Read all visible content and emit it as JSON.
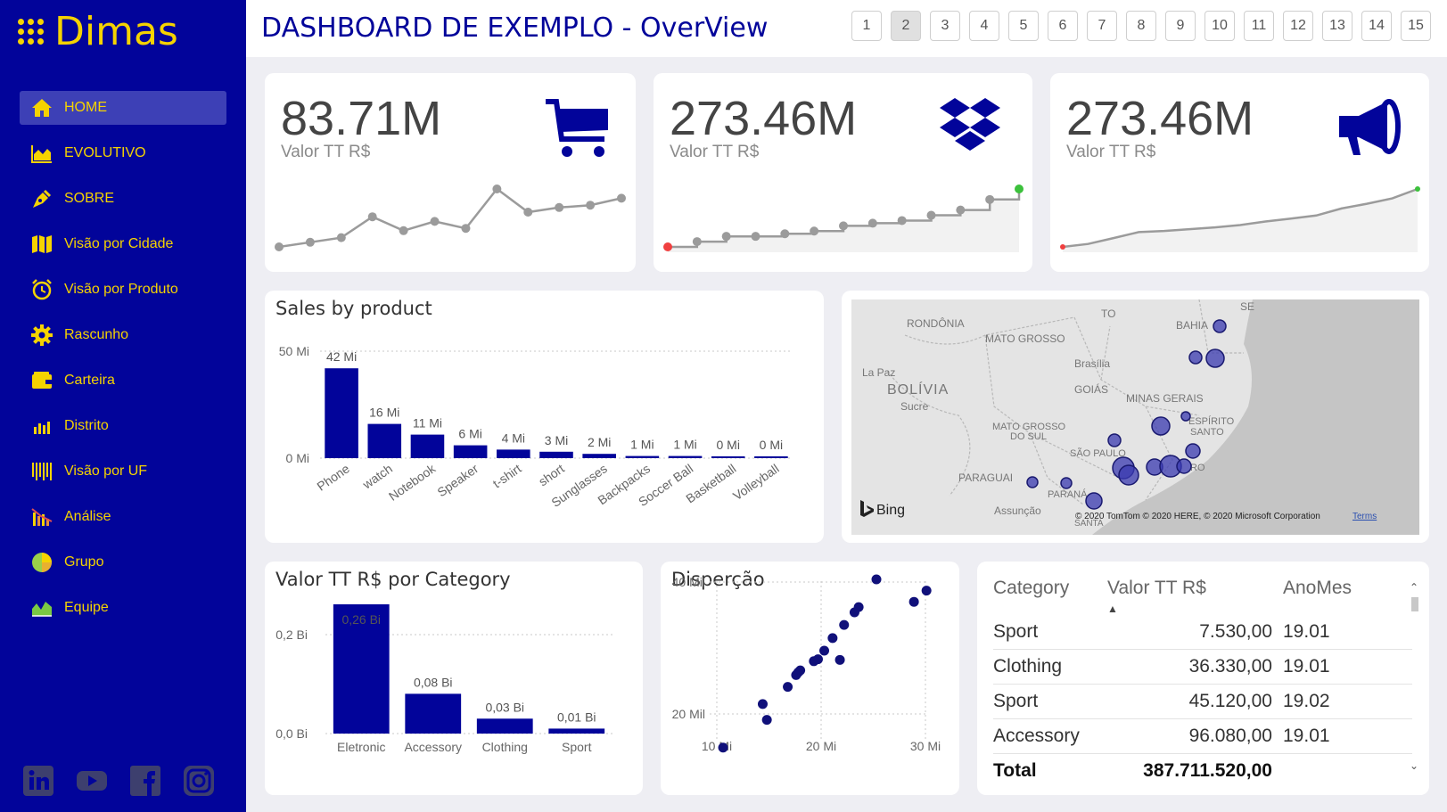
{
  "brand": {
    "name": "Dimas",
    "accent": "#f5d300",
    "sidebar_bg": "#02049a"
  },
  "nav": [
    {
      "label": "HOME",
      "icon": "home-icon",
      "active": true
    },
    {
      "label": "EVOLUTIVO",
      "icon": "area-chart-icon"
    },
    {
      "label": "SOBRE",
      "icon": "pen-nib-icon"
    },
    {
      "label": "Visão por Cidade",
      "icon": "map-icon"
    },
    {
      "label": "Visão por Produto",
      "icon": "alarm-clock-icon"
    },
    {
      "label": "Rascunho",
      "icon": "gear-icon"
    },
    {
      "label": "Carteira",
      "icon": "wallet-icon"
    },
    {
      "label": "Distrito",
      "icon": "bar-chart-icon"
    },
    {
      "label": "Visão por UF",
      "icon": "barcode-icon"
    },
    {
      "label": "Análise",
      "icon": "analysis-chart-icon"
    },
    {
      "label": "Grupo",
      "icon": "pie-chart-icon"
    },
    {
      "label": "Equipe",
      "icon": "area-chart-green-icon"
    }
  ],
  "socials": [
    "linkedin-icon",
    "youtube-icon",
    "facebook-icon",
    "instagram-icon"
  ],
  "header": {
    "title": "DASHBOARD DE EXEMPLO - OverView"
  },
  "pages": [
    "1",
    "2",
    "3",
    "4",
    "5",
    "6",
    "7",
    "8",
    "9",
    "10",
    "11",
    "12",
    "13",
    "14",
    "15"
  ],
  "current_page": "2",
  "kpis": [
    {
      "value": "83.71M",
      "label": "Valor TT R$",
      "icon": "shopping-cart-icon"
    },
    {
      "value": "273.46M",
      "label": "Valor TT R$",
      "icon": "dropbox-icon"
    },
    {
      "value": "273.46M",
      "label": "Valor TT R$",
      "icon": "megaphone-icon"
    }
  ],
  "map": {
    "labels": [
      "RONDÔNIA",
      "MATO GROSSO",
      "TO",
      "BAHIA",
      "SE",
      "La Paz",
      "BOLÍVIA",
      "Sucre",
      "Brasília",
      "GOIÁS",
      "MINAS GERAIS",
      "ESPÍRITO",
      "SANTO",
      "MATO GROSSO",
      "DO SUL",
      "SÃO PAULO",
      "PARAGUAI",
      "PARANÁ",
      "Assunção",
      "RO",
      "SANTA"
    ],
    "bing": "Bing",
    "attribution": "© 2020 TomTom © 2020 HERE, © 2020 Microsoft Corporation",
    "terms": "Terms"
  },
  "table": {
    "headers": [
      "Category",
      "Valor TT R$",
      "AnoMes"
    ],
    "rows": [
      [
        "Sport",
        "7.530,00",
        "19.01"
      ],
      [
        "Clothing",
        "36.330,00",
        "19.01"
      ],
      [
        "Sport",
        "45.120,00",
        "19.02"
      ],
      [
        "Accessory",
        "96.080,00",
        "19.01"
      ]
    ],
    "total_label": "Total",
    "total_value": "387.711.520,00"
  },
  "chart_data": [
    {
      "id": "kpi1",
      "type": "line",
      "title": "",
      "values": [
        0.5,
        1.5,
        2.5,
        7.0,
        4.0,
        6.0,
        4.5,
        13.0,
        8.0,
        9.0,
        9.5,
        11.0
      ],
      "color": "#9b9b9b"
    },
    {
      "id": "kpi2",
      "type": "line",
      "title": "",
      "step": true,
      "values": [
        0,
        1,
        2,
        2,
        2.5,
        3,
        4,
        4.5,
        5,
        6,
        7,
        9,
        11
      ],
      "color": "#9b9b9b",
      "start_color": "#f04040",
      "end_color": "#3cc13c"
    },
    {
      "id": "kpi3",
      "type": "area",
      "title": "",
      "values": [
        0,
        0.5,
        1.5,
        2.5,
        2.7,
        3.0,
        3.3,
        3.7,
        4.3,
        4.8,
        5.3,
        6.5,
        7.3,
        8.2,
        9.8
      ],
      "color": "#9b9b9b",
      "start_color": "#f04040",
      "end_color": "#3cc13c"
    },
    {
      "id": "sales",
      "type": "bar",
      "title": "Sales by product",
      "categories": [
        "Phone",
        "watch",
        "Notebook",
        "Speaker",
        "t-shirt",
        "short",
        "Sunglasses",
        "Backpacks",
        "Soccer Ball",
        "Basketball",
        "Volleyball"
      ],
      "values": [
        42,
        16,
        11,
        6,
        4,
        3,
        2,
        1,
        1,
        0.3,
        0.2
      ],
      "data_labels": [
        "42 Mi",
        "16 Mi",
        "11 Mi",
        "6 Mi",
        "4 Mi",
        "3 Mi",
        "2 Mi",
        "1 Mi",
        "1 Mi",
        "0 Mi",
        "0 Mi"
      ],
      "yticks": [
        "50 Mi",
        "0 Mi"
      ],
      "ylim": [
        0,
        50
      ],
      "color": "#02049a"
    },
    {
      "id": "category",
      "type": "bar",
      "title": "Valor TT R$ por Category",
      "categories": [
        "Eletronic",
        "Accessory",
        "Clothing",
        "Sport"
      ],
      "values": [
        0.26,
        0.08,
        0.03,
        0.01
      ],
      "data_labels": [
        "0,26 Bi",
        "0,08 Bi",
        "0,03 Bi",
        "0,01 Bi"
      ],
      "yticks": [
        "0,2 Bi",
        "0,0 Bi"
      ],
      "ylim": [
        0,
        0.26
      ],
      "color": "#02049a"
    },
    {
      "id": "scatter",
      "type": "scatter",
      "title": "Disperção",
      "xticks": [
        "10 Mi",
        "20 Mi",
        "30 Mi"
      ],
      "yticks": [
        "40 Mil",
        "20 Mil"
      ],
      "xlim": [
        10,
        30
      ],
      "ylim": [
        20,
        40
      ],
      "color": "#10107a",
      "points": [
        [
          10.6,
          14.9
        ],
        [
          14.4,
          21.5
        ],
        [
          14.8,
          19.1
        ],
        [
          16.8,
          24.1
        ],
        [
          17.6,
          25.9
        ],
        [
          17.8,
          26.3
        ],
        [
          18.0,
          26.6
        ],
        [
          19.3,
          28.0
        ],
        [
          19.7,
          28.3
        ],
        [
          20.3,
          29.6
        ],
        [
          21.1,
          31.5
        ],
        [
          22.2,
          33.5
        ],
        [
          21.8,
          28.2
        ],
        [
          23.2,
          35.4
        ],
        [
          23.6,
          36.2
        ],
        [
          25.3,
          40.4
        ],
        [
          28.9,
          37.0
        ],
        [
          30.1,
          38.7
        ]
      ]
    }
  ]
}
